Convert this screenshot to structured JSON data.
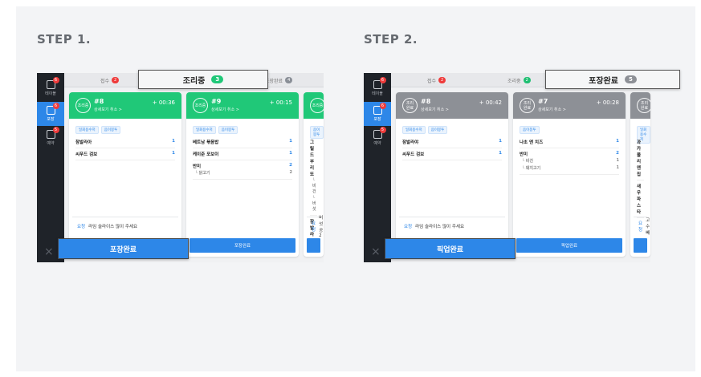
{
  "step1": {
    "title": "STEP 1.",
    "sidebar": [
      {
        "label": "테이블",
        "badge": "6",
        "active": false
      },
      {
        "label": "포장",
        "badge": "6",
        "active": true
      },
      {
        "label": "예약",
        "badge": "5",
        "active": false
      }
    ],
    "tabs": [
      {
        "label": "접수",
        "count": "2"
      },
      {
        "label": "조리중",
        "count": "3"
      },
      {
        "label": "포장완료",
        "count": "4"
      }
    ],
    "callout_tab": {
      "label": "조리중",
      "count": "3"
    },
    "cards": [
      {
        "status": "조리중",
        "number": "#8",
        "sub": "상세보기 취소 >",
        "time": "+ 00:36",
        "tags": [
          "일회용수저",
          "음이봉투"
        ],
        "items": [
          {
            "name": "참발라아",
            "qty": "1",
            "options": []
          },
          {
            "name": "씨푸드 검보",
            "qty": "1",
            "options": []
          }
        ],
        "request_label": "요청",
        "request_text": "라임 슬라이스 많이 주세요",
        "button": "포장완료"
      },
      {
        "status": "조리중",
        "number": "#9",
        "sub": "상세보기 취소 >",
        "time": "+ 00:15",
        "tags": [
          "일회용수저",
          "음이봉투"
        ],
        "items": [
          {
            "name": "베트남 볶음밥",
            "qty": "1",
            "options": []
          },
          {
            "name": "케이준 포보이",
            "qty": "1",
            "options": []
          },
          {
            "name": "반미",
            "qty": "2",
            "options": [
              {
                "name": "닭고기",
                "qty": "2"
              }
            ]
          }
        ],
        "request_label": "",
        "request_text": "",
        "button": "포장완료"
      },
      {
        "status": "조리중",
        "number": "#2",
        "sub": "상세보",
        "time": "",
        "tags": [
          "음이봉투"
        ],
        "items": [
          {
            "name": "그릴드 부리또",
            "qty": "",
            "options": [
              {
                "name": "비건",
                "qty": ""
              },
              {
                "name": "버섯",
                "qty": ""
              }
            ]
          },
          {
            "name": "잠발라야",
            "qty": "",
            "options": []
          }
        ],
        "request_label": "요청",
        "request_text": "버섯 공2",
        "button": ""
      }
    ],
    "callout_button": "포장완료"
  },
  "step2": {
    "title": "STEP 2.",
    "sidebar": [
      {
        "label": "테이블",
        "badge": "6",
        "active": false
      },
      {
        "label": "포장",
        "badge": "6",
        "active": true
      },
      {
        "label": "예약",
        "badge": "5",
        "active": false
      }
    ],
    "tabs": [
      {
        "label": "접수",
        "count": "2"
      },
      {
        "label": "조리중",
        "count": "2"
      },
      {
        "label": "포장완료",
        "count": "5"
      }
    ],
    "callout_tab": {
      "label": "포장완료",
      "count": "5"
    },
    "cards": [
      {
        "status": "조리\n완료",
        "number": "#8",
        "sub": "상세보기 취소 >",
        "time": "+ 00:42",
        "tags": [
          "일회용수저",
          "음이봉투"
        ],
        "items": [
          {
            "name": "잠발라야",
            "qty": "1",
            "options": []
          },
          {
            "name": "씨푸드 검보",
            "qty": "1",
            "options": []
          }
        ],
        "request_label": "요청",
        "request_text": "라임 슬라이스 많이 주세요",
        "button": "픽업완료"
      },
      {
        "status": "조리\n완료",
        "number": "#7",
        "sub": "상세보기 취소 >",
        "time": "+ 00:28",
        "tags": [
          "음이봉투"
        ],
        "items": [
          {
            "name": "나초 앤 치즈",
            "qty": "1",
            "options": []
          },
          {
            "name": "반미",
            "qty": "2",
            "options": [
              {
                "name": "비건",
                "qty": "1"
              },
              {
                "name": "돼지고기",
                "qty": "1"
              }
            ]
          }
        ],
        "request_label": "",
        "request_text": "",
        "button": "픽업완료"
      },
      {
        "status": "조리\n완료",
        "number": "#23",
        "sub": "상세",
        "time": "",
        "tags": [
          "일회용수저"
        ],
        "items": [
          {
            "name": "과카몰리 앤 칩",
            "qty": "",
            "options": []
          },
          {
            "name": "새우 파스타",
            "qty": "",
            "options": []
          }
        ],
        "request_label": "요청",
        "request_text": "고수 빼",
        "button": ""
      }
    ],
    "callout_button": "픽업완료"
  },
  "colors": {
    "cooking_header": "#20c878",
    "done_header": "#8d9096",
    "primary_button": "#2d87e8",
    "badge_red": "#ef3b3b",
    "sidebar_bg": "#1f2329"
  }
}
